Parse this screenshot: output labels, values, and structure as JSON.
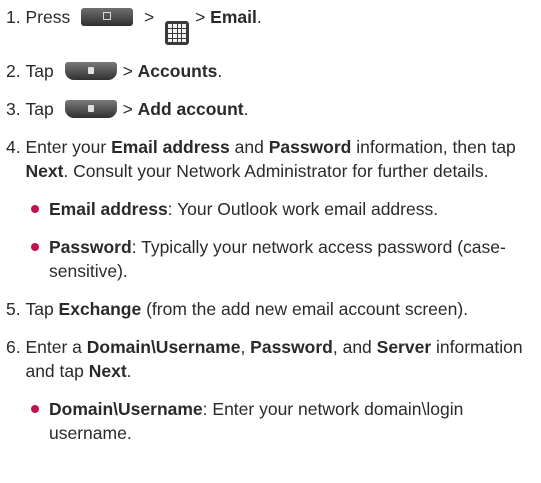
{
  "steps": {
    "s1": {
      "num": "1. ",
      "a": "Press",
      "b": ">",
      "c": "> ",
      "d": "Email",
      "e": "."
    },
    "s2": {
      "num": "2. ",
      "a": "Tap",
      "b": "> ",
      "c": "Accounts",
      "d": "."
    },
    "s3": {
      "num": "3. ",
      "a": "Tap",
      "b": "> ",
      "c": "Add account",
      "d": "."
    },
    "s4": {
      "num": "4. ",
      "t1": "Enter your ",
      "t2": "Email address",
      "t3": " and ",
      "t4": "Password",
      "t5": " information, then tap ",
      "t6": "Next",
      "t7": ". Consult your Network Administrator for further details.",
      "bullets": [
        {
          "label": "Email address",
          "text": ": Your Outlook work email address."
        },
        {
          "label": "Password",
          "text": ": Typically your network access password (case-sensitive)."
        }
      ]
    },
    "s5": {
      "num": "5. ",
      "t1": "Tap ",
      "t2": "Exchange",
      "t3": " (from the add new email account screen)."
    },
    "s6": {
      "num": "6. ",
      "t1": "Enter a ",
      "t2": "Domain\\Username",
      "t3": ", ",
      "t4": "Password",
      "t5": ", and ",
      "t6": "Server",
      "t7": " information and tap ",
      "t8": "Next",
      "t9": ".",
      "bullets": [
        {
          "label": "Domain\\Username",
          "text": ": Enter your network domain\\login username."
        }
      ]
    }
  },
  "icons": {
    "home": "home-key-icon",
    "apps": "applications-grid-icon",
    "menu": "menu-key-icon"
  },
  "colors": {
    "bullet": "#c3114b",
    "text": "#2a2a2a"
  }
}
